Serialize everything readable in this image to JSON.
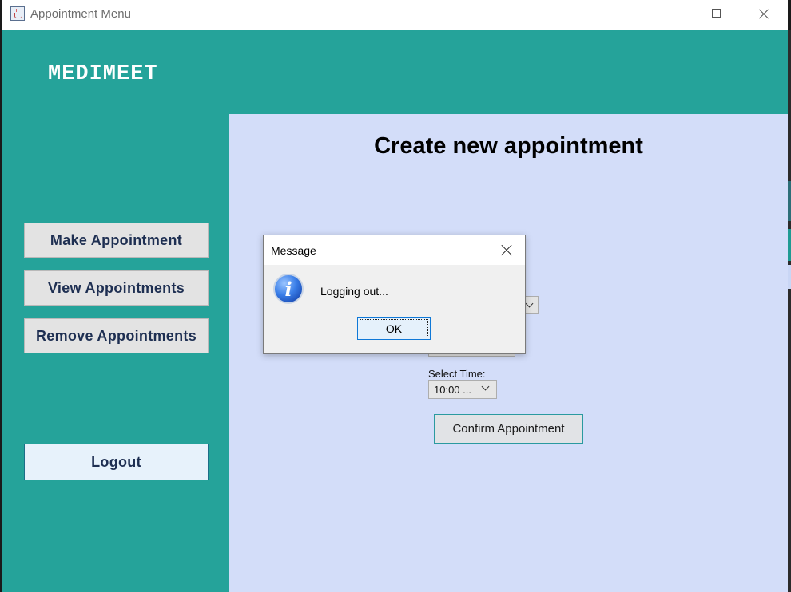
{
  "window": {
    "title": "Appointment Menu",
    "accent_color": "#25a39a",
    "content_background": "#d3ddf9"
  },
  "brand": {
    "name": "MEDIMEET"
  },
  "sidebar": {
    "make_appointment": "Make Appointment",
    "view_appointments": "View Appointments",
    "remove_appointments": "Remove Appointments",
    "logout": "Logout"
  },
  "content": {
    "title": "Create new appointment",
    "time_label": "Select Time:",
    "time_value": "10:00 ...",
    "confirm_button": "Confirm Appointment"
  },
  "dialog": {
    "title": "Message",
    "message": "Logging out...",
    "ok_button": "OK",
    "icon": "information-icon"
  },
  "window_controls": {
    "minimize_icon": "minimize-icon",
    "maximize_icon": "maximize-icon",
    "close_icon": "close-icon"
  }
}
